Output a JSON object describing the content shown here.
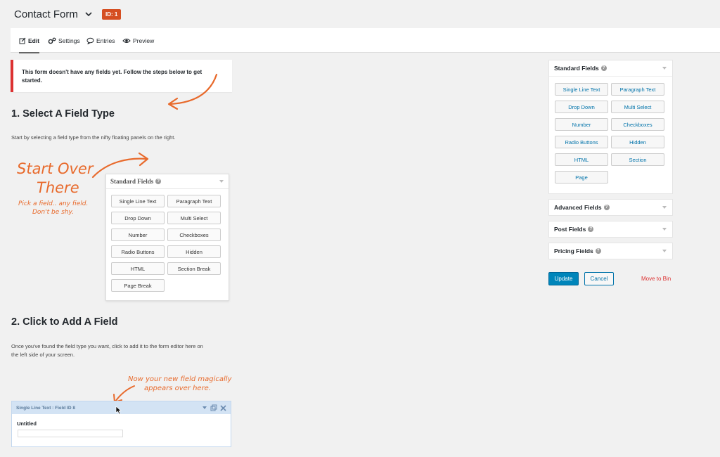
{
  "header": {
    "form_title": "Contact Form",
    "id_badge": "ID: 1"
  },
  "tabs": [
    {
      "label": "Edit",
      "icon": "edit-icon",
      "active": true
    },
    {
      "label": "Settings",
      "icon": "gears-icon",
      "active": false
    },
    {
      "label": "Entries",
      "icon": "comment-icon",
      "active": false
    },
    {
      "label": "Preview",
      "icon": "eye-icon",
      "active": false
    }
  ],
  "notice": {
    "text": "This form doesn't have any fields yet. Follow the steps below to get started."
  },
  "step1": {
    "heading": "1. Select A Field Type",
    "description": "Start by selecting a field type from the nifty floating panels on the right.",
    "handwriting_main_line1": "Start Over",
    "handwriting_main_line2": "There",
    "handwriting_sub_line1": "Pick a field.. any field.",
    "handwriting_sub_line2": "Don't be shy."
  },
  "demo_panel": {
    "title": "Standard Fields",
    "buttons": [
      "Single Line Text",
      "Paragraph Text",
      "Drop Down",
      "Multi Select",
      "Number",
      "Checkboxes",
      "Radio Buttons",
      "Hidden",
      "HTML",
      "Section Break",
      "Page Break"
    ]
  },
  "step2": {
    "heading": "2. Click to Add A Field",
    "description_line1": "Once you've found the field type you want, click to add it to the form editor here on",
    "description_line2": "the left side of your screen.",
    "handwriting_line1": "Now your new field magically",
    "handwriting_line2": "appears over here."
  },
  "demo_field": {
    "header": "Single Line Text : Field ID 8",
    "label": "Untitled"
  },
  "sidebar": {
    "standard": {
      "title": "Standard Fields",
      "buttons": [
        "Single Line Text",
        "Paragraph Text",
        "Drop Down",
        "Multi Select",
        "Number",
        "Checkboxes",
        "Radio Buttons",
        "Hidden",
        "HTML",
        "Section",
        "Page"
      ]
    },
    "advanced_title": "Advanced Fields",
    "post_title": "Post Fields",
    "pricing_title": "Pricing Fields"
  },
  "actions": {
    "update": "Update",
    "cancel": "Cancel",
    "move_to_bin": "Move to Bin"
  },
  "colors": {
    "accent": "#0085ba",
    "link": "#0073aa",
    "danger": "#dc3232",
    "badge": "#d54e21",
    "handwriting": "#e86a2c"
  }
}
